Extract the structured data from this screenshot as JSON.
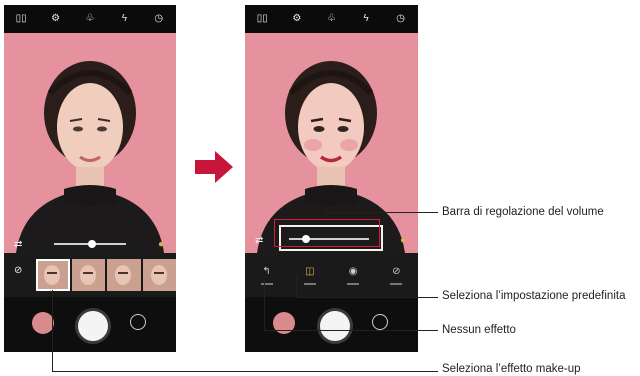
{
  "topbar_icons": [
    "split-view-icon",
    "settings-icon",
    "filter-icon",
    "flash-off-icon",
    "timer-icon"
  ],
  "topbar_glyphs": [
    "▯▯",
    "⚙",
    "♧",
    "ϟ",
    "◷"
  ],
  "annotations": {
    "volume_bar": "Barra di regolazione del volume",
    "preset_select": "Seleziona l’impostazione predefinita",
    "no_effect": "Nessun effetto",
    "makeup_select": "Seleziona l’effetto make-up"
  },
  "colors": {
    "accent": "#d21f3c",
    "background": "#e6919e",
    "active_icon": "#d9b24a"
  },
  "bottom_icons": [
    "gallery-thumbnail",
    "shutter-button",
    "switch-camera-icon"
  ],
  "effect_icons": [
    "undo-icon",
    "makeup-icon",
    "eye-icon",
    "no-effect-icon"
  ]
}
